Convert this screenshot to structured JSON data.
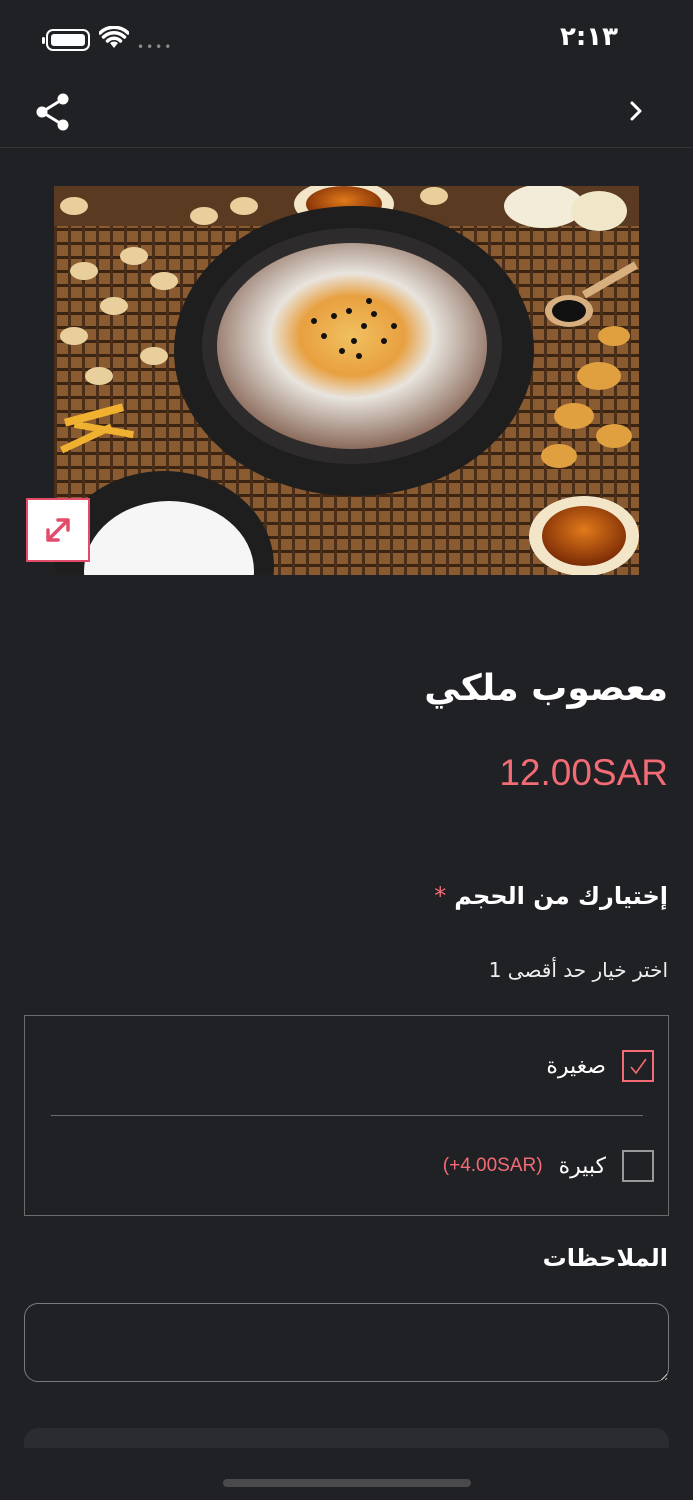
{
  "status": {
    "time": "٢:١٣"
  },
  "nav": {
    "share_icon": "share-icon",
    "back_icon": "chevron-right-icon"
  },
  "product": {
    "title": "معصوب ملكي",
    "price": "12.00SAR",
    "image_desc": "food-photo"
  },
  "size_section": {
    "label": "إختيارك من الحجم",
    "required_mark": "*",
    "hint": "اختر خيار حد أقصى 1",
    "options": [
      {
        "label": "صغيرة",
        "checked": true,
        "extra": ""
      },
      {
        "label": "كبيرة",
        "checked": false,
        "extra": "(+4.00SAR)"
      }
    ]
  },
  "notes": {
    "label": "الملاحظات",
    "value": ""
  },
  "colors": {
    "accent": "#f36b75",
    "background": "#202124"
  }
}
